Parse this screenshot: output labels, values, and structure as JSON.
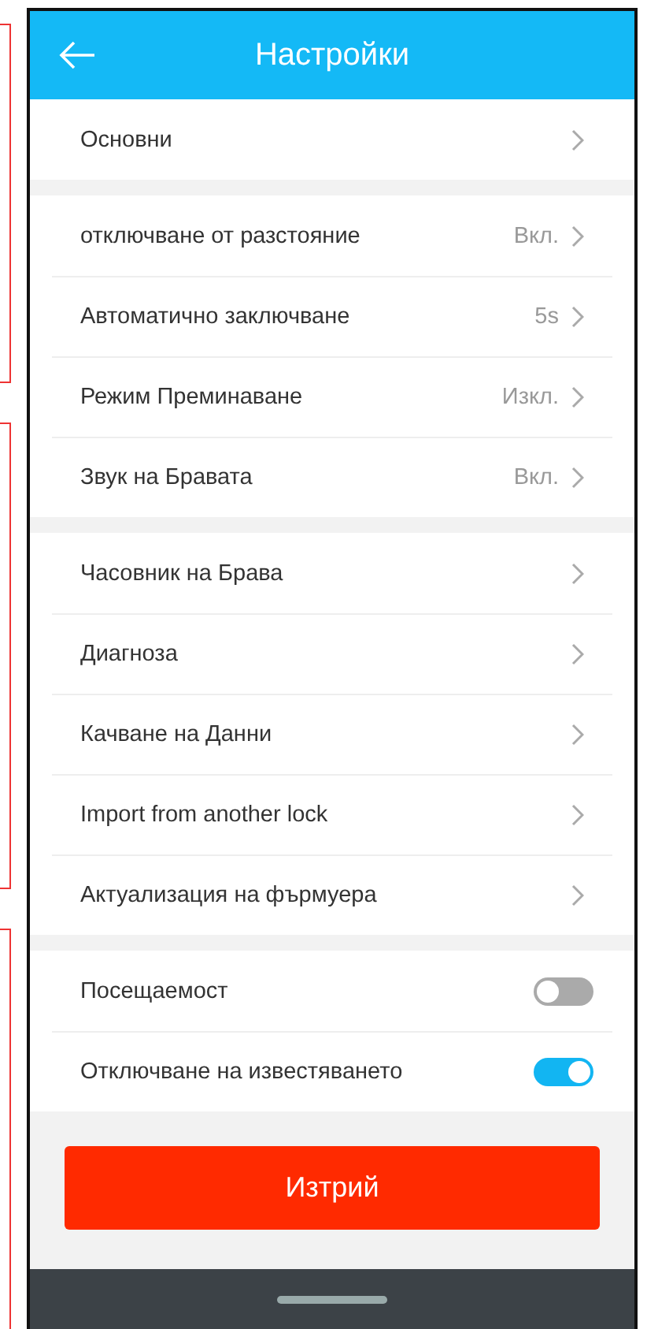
{
  "header": {
    "title": "Настройки"
  },
  "groups": [
    {
      "rows": [
        {
          "kind": "link",
          "label": "Основни"
        }
      ]
    },
    {
      "rows": [
        {
          "kind": "link",
          "label": "отключване от разстояние",
          "value": "Вкл."
        },
        {
          "kind": "link",
          "label": "Автоматично заключване",
          "value": "5s"
        },
        {
          "kind": "link",
          "label": "Режим Преминаване",
          "value": "Изкл."
        },
        {
          "kind": "link",
          "label": "Звук на Бравата",
          "value": "Вкл."
        }
      ]
    },
    {
      "rows": [
        {
          "kind": "link",
          "label": "Часовник на Брава"
        },
        {
          "kind": "link",
          "label": "Диагноза"
        },
        {
          "kind": "link",
          "label": "Качване на Данни"
        },
        {
          "kind": "link",
          "label": "Import from another lock"
        },
        {
          "kind": "link",
          "label": "Актуализация на фърмуера"
        }
      ]
    },
    {
      "rows": [
        {
          "kind": "toggle",
          "label": "Посещаемост",
          "on": false
        },
        {
          "kind": "toggle",
          "label": "Отключване на известяването",
          "on": true
        }
      ]
    }
  ],
  "delete_button": "Изтрий"
}
